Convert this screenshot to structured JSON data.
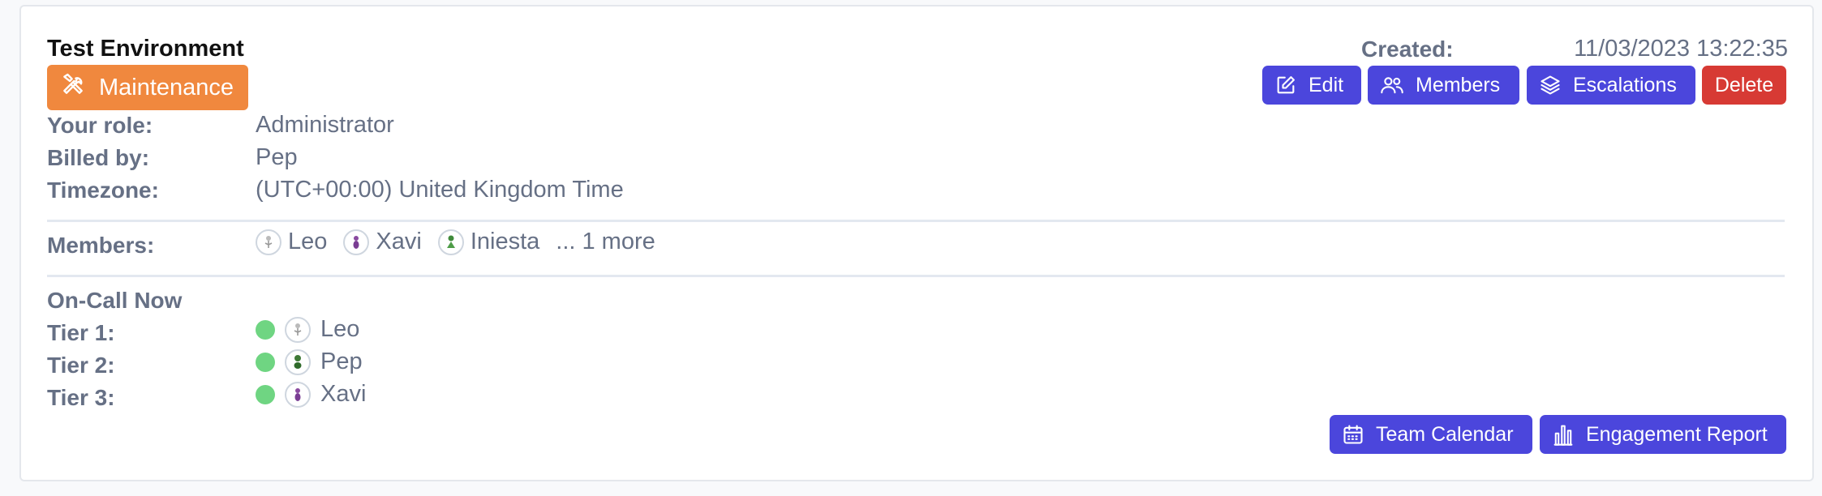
{
  "environment": {
    "title": "Test Environment",
    "status_badge": "Maintenance"
  },
  "created": {
    "label": "Created:",
    "value": "11/03/2023 13:22:35"
  },
  "actions": {
    "edit": "Edit",
    "members": "Members",
    "escalations": "Escalations",
    "delete": "Delete"
  },
  "details": {
    "role_label": "Your role:",
    "role_value": "Administrator",
    "billed_label": "Billed by:",
    "billed_value": "Pep",
    "timezone_label": "Timezone:",
    "timezone_value": "(UTC+00:00) United Kingdom Time"
  },
  "members_section": {
    "label": "Members:",
    "list": [
      "Leo",
      "Xavi",
      "Iniesta"
    ],
    "more": "... 1 more"
  },
  "on_call": {
    "heading": "On-Call Now",
    "tiers": [
      {
        "label": "Tier 1:",
        "name": "Leo"
      },
      {
        "label": "Tier 2:",
        "name": "Pep"
      },
      {
        "label": "Tier 3:",
        "name": "Xavi"
      }
    ]
  },
  "footer_actions": {
    "team_calendar": "Team Calendar",
    "engagement_report": "Engagement Report"
  },
  "colors": {
    "primary_button": "#4b46dc",
    "danger_button": "#d73a34",
    "maintenance_badge": "#f0883e",
    "online_status": "#6fd582"
  }
}
